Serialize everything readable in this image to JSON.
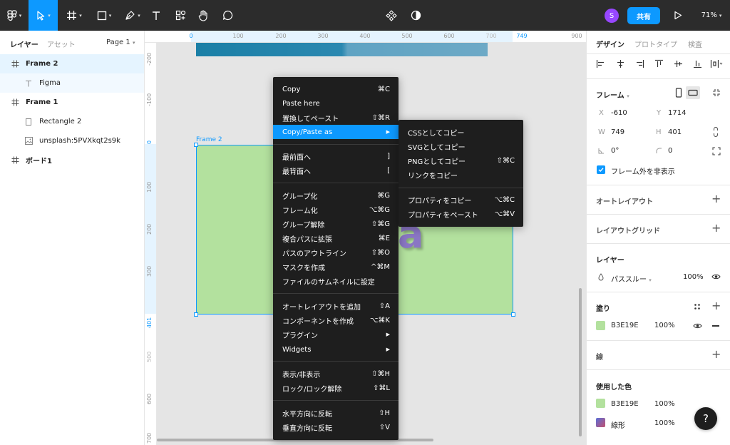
{
  "toolbar": {
    "avatar_initial": "S",
    "share_label": "共有",
    "zoom": "71%"
  },
  "left_panel": {
    "tab_layers": "レイヤー",
    "tab_assets": "アセット",
    "page": "Page 1",
    "layers": [
      {
        "name": "Frame 2",
        "icon": "frame-icon"
      },
      {
        "name": "Figma",
        "icon": "text-icon"
      },
      {
        "name": "Frame 1",
        "icon": "frame-icon"
      },
      {
        "name": "Rectangle 2",
        "icon": "rectangle-icon"
      },
      {
        "name": "unsplash:5PVXkqt2s9k",
        "icon": "image-icon"
      },
      {
        "name": "ボード1",
        "icon": "frame-icon"
      }
    ]
  },
  "ruler": {
    "top": [
      "0",
      "100",
      "200",
      "300",
      "400",
      "500",
      "600",
      "700",
      "749",
      "900"
    ],
    "left": [
      "-200",
      "-100",
      "0",
      "100",
      "200",
      "300",
      "401",
      "500",
      "600",
      "700"
    ]
  },
  "canvas": {
    "frame_label": "Frame 2",
    "frame_text": "a",
    "frame_fill": "#B3E19E",
    "accent": "#0d99ff"
  },
  "context_menu": {
    "groups": [
      [
        {
          "label": "Copy",
          "shortcut": "⌘C"
        },
        {
          "label": "Paste here",
          "shortcut": ""
        },
        {
          "label": "置換してペースト",
          "shortcut": "⇧⌘R"
        },
        {
          "label": "Copy/Paste as",
          "shortcut": "▶",
          "highlighted": true
        }
      ],
      [
        {
          "label": "最前面へ",
          "shortcut": "]"
        },
        {
          "label": "最背面へ",
          "shortcut": "["
        }
      ],
      [
        {
          "label": "グループ化",
          "shortcut": "⌘G"
        },
        {
          "label": "フレーム化",
          "shortcut": "⌥⌘G"
        },
        {
          "label": "グループ解除",
          "shortcut": "⇧⌘G"
        },
        {
          "label": "複合パスに拡張",
          "shortcut": "⌘E"
        },
        {
          "label": "パスのアウトライン",
          "shortcut": "⇧⌘O"
        },
        {
          "label": "マスクを作成",
          "shortcut": "^⌘M"
        },
        {
          "label": "ファイルのサムネイルに設定",
          "shortcut": ""
        }
      ],
      [
        {
          "label": "オートレイアウトを追加",
          "shortcut": "⇧A"
        },
        {
          "label": "コンポーネントを作成",
          "shortcut": "⌥⌘K"
        },
        {
          "label": "プラグイン",
          "shortcut": "▶"
        },
        {
          "label": "Widgets",
          "shortcut": "▶"
        }
      ],
      [
        {
          "label": "表示/非表示",
          "shortcut": "⇧⌘H"
        },
        {
          "label": "ロック/ロック解除",
          "shortcut": "⇧⌘L"
        }
      ],
      [
        {
          "label": "水平方向に反転",
          "shortcut": "⇧H"
        },
        {
          "label": "垂直方向に反転",
          "shortcut": "⇧V"
        }
      ]
    ]
  },
  "submenu": {
    "groups": [
      [
        {
          "label": "CSSとしてコピー",
          "shortcut": ""
        },
        {
          "label": "SVGとしてコピー",
          "shortcut": ""
        },
        {
          "label": "PNGとしてコピー",
          "shortcut": "⇧⌘C"
        },
        {
          "label": "リンクをコピー",
          "shortcut": ""
        }
      ],
      [
        {
          "label": "プロパティをコピー",
          "shortcut": "⌥⌘C"
        },
        {
          "label": "プロパティをペースト",
          "shortcut": "⌥⌘V"
        }
      ]
    ]
  },
  "right_panel": {
    "tabs": [
      "デザイン",
      "プロトタイプ",
      "検査"
    ],
    "frame": {
      "title": "フレーム",
      "x_label": "X",
      "x": "-610",
      "y_label": "Y",
      "y": "1714",
      "w_label": "W",
      "w": "749",
      "h_label": "H",
      "h": "401",
      "rotation": "0°",
      "radius": "0",
      "clip_label": "フレーム外を非表示"
    },
    "auto_layout": "オートレイアウト",
    "layout_grid": "レイアウトグリッド",
    "layer": {
      "title": "レイヤー",
      "blend": "パススルー",
      "opacity": "100%"
    },
    "fill": {
      "title": "塗り",
      "color": "B3E19E",
      "opacity": "100%",
      "swatch": "#B3E19E"
    },
    "stroke_title": "線",
    "used_colors": {
      "title": "使用した色",
      "items": [
        {
          "name": "B3E19E",
          "opacity": "100%",
          "swatch": "#B3E19E"
        },
        {
          "name": "線形",
          "opacity": "100%",
          "swatch": "linear"
        }
      ]
    },
    "help": "?"
  }
}
